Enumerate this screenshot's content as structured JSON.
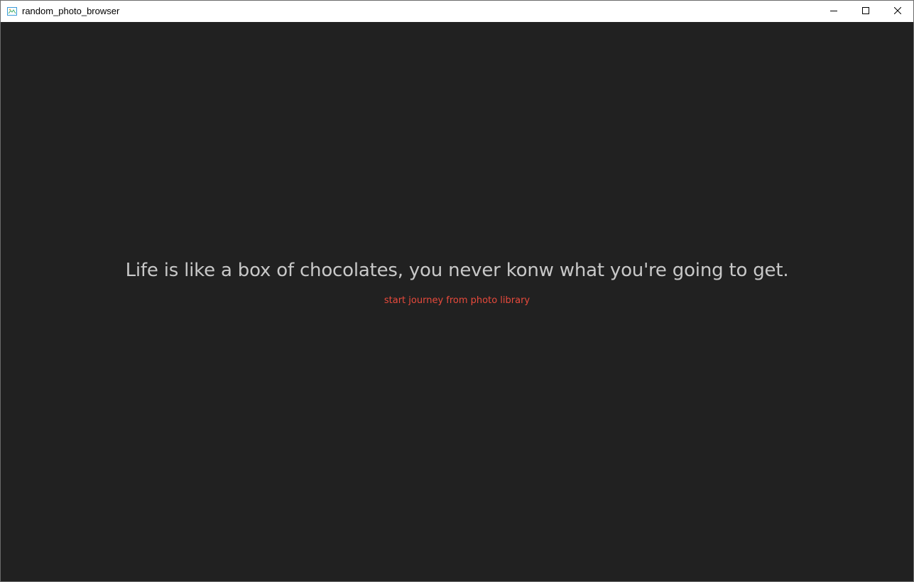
{
  "window": {
    "title": "random_photo_browser",
    "app_icon": "image-icon",
    "controls": {
      "minimize_icon": "minimize-icon",
      "maximize_icon": "maximize-icon",
      "close_icon": "close-icon"
    }
  },
  "main": {
    "quote": "Life is like a box of chocolates, you never konw what you're going to get.",
    "start_link": "start journey from photo library"
  },
  "colors": {
    "background": "#212121",
    "quote_text": "#c8c8c8",
    "link_text": "#e84a3c",
    "titlebar": "#ffffff"
  }
}
